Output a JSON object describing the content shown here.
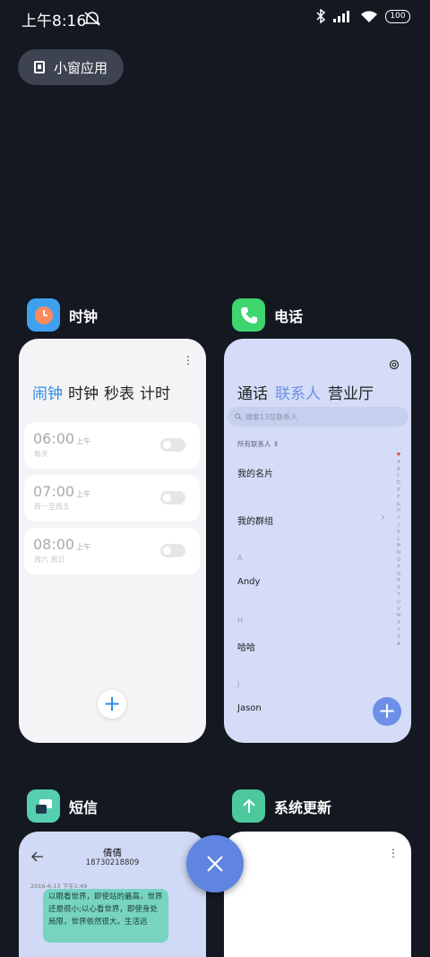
{
  "status": {
    "time": "上午8:16",
    "battery": "100"
  },
  "floating_button": {
    "label": "小窗应用"
  },
  "apps": {
    "clock": {
      "name": "时钟",
      "tabs": [
        "闹钟",
        "时钟",
        "秒表",
        "计时"
      ],
      "alarms": [
        {
          "time": "06:00",
          "ampm": "上午",
          "repeat": "每天"
        },
        {
          "time": "07:00",
          "ampm": "上午",
          "repeat": "周一至周五"
        },
        {
          "time": "08:00",
          "ampm": "上午",
          "repeat": "周六 周日"
        }
      ],
      "add": "+"
    },
    "phone": {
      "name": "电话",
      "tabs": [
        "通话",
        "联系人",
        "营业厅"
      ],
      "search_placeholder": "搜索13位联系人",
      "filter": "所有联系人",
      "my_card": "我的名片",
      "my_groups": "我的群组",
      "sections": [
        {
          "letter": "A",
          "name": "Andy"
        },
        {
          "letter": "H",
          "name": "哈哈"
        },
        {
          "letter": "J",
          "name": "Jason"
        }
      ],
      "index_letters": [
        "♥",
        "A",
        "B",
        "C",
        "D",
        "E",
        "F",
        "G",
        "H",
        "I",
        "J",
        "K",
        "L",
        "M",
        "N",
        "O",
        "P",
        "Q",
        "R",
        "S",
        "T",
        "U",
        "V",
        "W",
        "X",
        "Y",
        "Z",
        "#"
      ],
      "add": "+"
    },
    "sms": {
      "name": "短信",
      "contact_name": "倩倩",
      "contact_number": "18730218809",
      "timestamp": "2016-6-13 下午1:49",
      "message": "以眼看世界，即使站的最高，世界还是很小;以心看世界，即使身处局限，世界依然很大。生活远"
    },
    "update": {
      "name": "系统更新"
    }
  },
  "colors": {
    "background": "#141821",
    "clock_accent": "#2a8be8",
    "phone_accent": "#6d8fe8",
    "close_button": "#5f85e0"
  }
}
